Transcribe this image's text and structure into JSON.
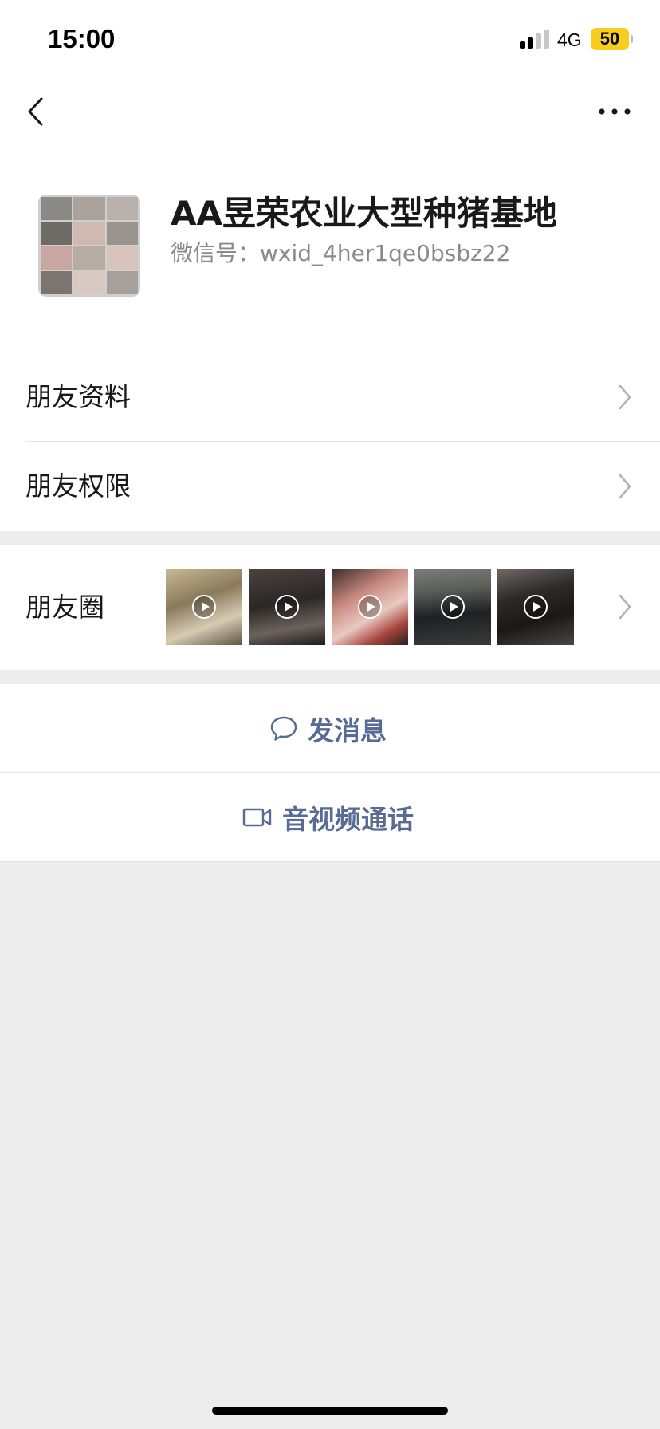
{
  "status_bar": {
    "time": "15:00",
    "network": "4G",
    "battery": "50",
    "battery_color": "#f7ce1e",
    "signal_bars_active": 2,
    "signal_bars_total": 4
  },
  "nav": {
    "back_icon": "chevron-left-icon",
    "more_icon": "more-horizontal-icon"
  },
  "profile": {
    "name": "AA昱荣农业大型种猪基地",
    "wxid": "微信号：wxid_4her1qe0bsbz22",
    "avatar_icon": "pig-collage-avatar"
  },
  "cells": [
    {
      "label": "朋友资料"
    },
    {
      "label": "朋友权限"
    }
  ],
  "moments": {
    "label": "朋友圈",
    "thumbnails": [
      {
        "alt": "video-thumbnail-1",
        "is_video": true
      },
      {
        "alt": "video-thumbnail-2",
        "is_video": true
      },
      {
        "alt": "video-thumbnail-3",
        "is_video": true
      },
      {
        "alt": "video-thumbnail-4",
        "is_video": true
      },
      {
        "alt": "video-thumbnail-5",
        "is_video": true
      }
    ]
  },
  "actions": {
    "message": {
      "label": "发消息",
      "icon": "chat-bubble-icon"
    },
    "call": {
      "label": "音视频通话",
      "icon": "video-camera-icon"
    }
  },
  "colors": {
    "accent": "#576b95",
    "background": "#ededed",
    "cell": "#ffffff",
    "divider": "#e5e5e5",
    "secondary_text": "#8a8a8a",
    "chevron": "#b2b2b2"
  }
}
